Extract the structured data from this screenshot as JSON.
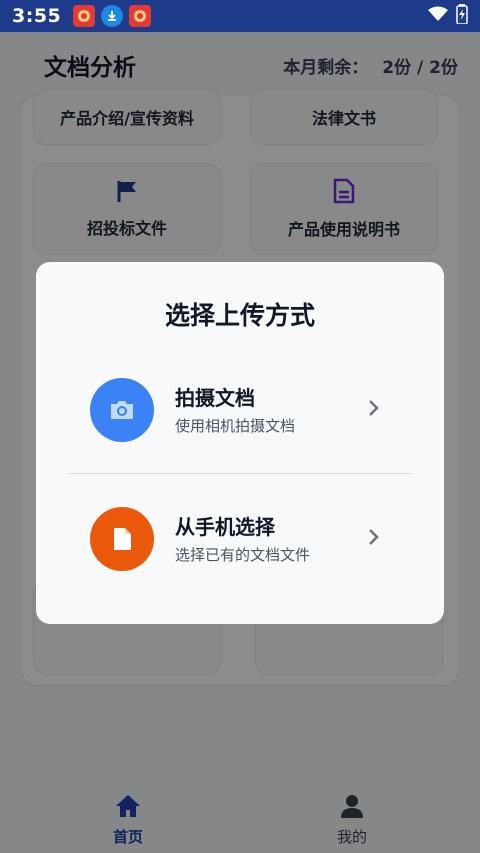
{
  "status_bar": {
    "time": "3:55",
    "app_icons": [
      {
        "name": "app-icon-red",
        "color": "#e53935"
      },
      {
        "name": "download-icon",
        "color": "#1e88e5"
      },
      {
        "name": "app-icon-red-2",
        "color": "#e53935"
      }
    ]
  },
  "header": {
    "title": "文档分析",
    "quota_label": "本月剩余：",
    "quota_value": "2份 / 2份"
  },
  "tiles": [
    {
      "label": "产品介绍/宣传资料",
      "icon": ""
    },
    {
      "label": "法律文书",
      "icon": ""
    },
    {
      "label": "招投标文件",
      "icon": "flag-icon"
    },
    {
      "label": "产品使用说明书",
      "icon": "document-icon"
    }
  ],
  "bottom_nav": {
    "home_label": "首页",
    "mine_label": "我的"
  },
  "modal": {
    "title": "选择上传方式",
    "options": [
      {
        "title": "拍摄文档",
        "subtitle": "使用相机拍摄文档",
        "icon": "camera-icon",
        "color": "#3b82f6"
      },
      {
        "title": "从手机选择",
        "subtitle": "选择已有的文档文件",
        "icon": "file-icon",
        "color": "#ea580c"
      }
    ]
  },
  "colors": {
    "status_bar": "#1e3a8a",
    "accent": "#1e40af",
    "purple": "#6d28d9"
  }
}
